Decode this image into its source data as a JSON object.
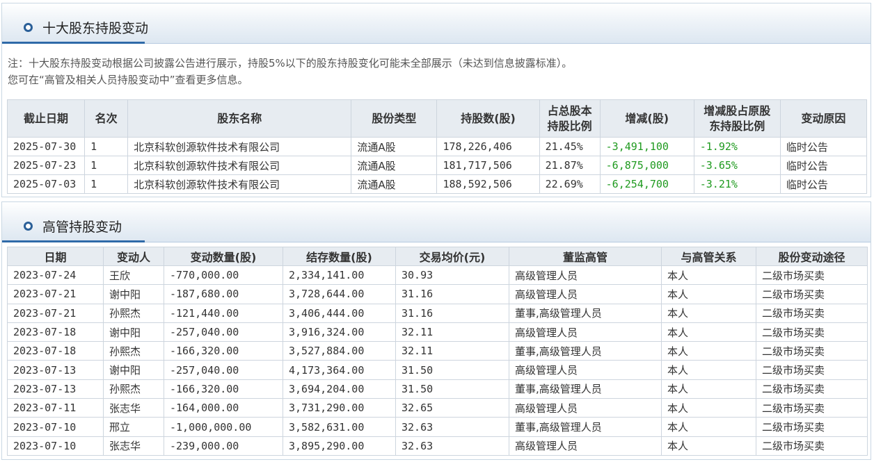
{
  "section1": {
    "title": "十大股东持股变动",
    "note_line1": "注：十大股东持股变动根据公司披露公告进行展示，持股5%以下的股东持股变化可能未全部展示（未达到信息披露标准）。",
    "note_line2": "您可在“高管及相关人员持股变动中”查看更多信息。",
    "headers": {
      "date": "截止日期",
      "rank": "名次",
      "holder": "股东名称",
      "share_type": "股份类型",
      "shares": "持股数(股)",
      "ratio_a": "占总股本",
      "ratio_b": "持股比例",
      "change": "增减(股)",
      "change_ratio_a": "增减股占原股",
      "change_ratio_b": "东持股比例",
      "reason": "变动原因"
    },
    "rows": [
      {
        "date": "2025-07-30",
        "rank": "1",
        "holder": "北京科软创源软件技术有限公司",
        "share_type": "流通A股",
        "shares": "178,226,406",
        "ratio": "21.45%",
        "change": "-3,491,100",
        "change_ratio": "-1.92%",
        "reason": "临时公告"
      },
      {
        "date": "2025-07-23",
        "rank": "1",
        "holder": "北京科软创源软件技术有限公司",
        "share_type": "流通A股",
        "shares": "181,717,506",
        "ratio": "21.87%",
        "change": "-6,875,000",
        "change_ratio": "-3.65%",
        "reason": "临时公告"
      },
      {
        "date": "2025-07-03",
        "rank": "1",
        "holder": "北京科软创源软件技术有限公司",
        "share_type": "流通A股",
        "shares": "188,592,506",
        "ratio": "22.69%",
        "change": "-6,254,700",
        "change_ratio": "-3.21%",
        "reason": "临时公告"
      }
    ]
  },
  "section2": {
    "title": "高管持股变动",
    "headers": {
      "date": "日期",
      "person": "变动人",
      "change_qty": "变动数量(股)",
      "remain_qty": "结存数量(股)",
      "avg_price": "交易均价(元)",
      "position": "董监高管",
      "relation": "与高管关系",
      "channel": "股份变动途径"
    },
    "rows": [
      {
        "date": "2023-07-24",
        "person": "王欣",
        "change_qty": "-770,000.00",
        "remain_qty": "2,334,141.00",
        "avg_price": "30.93",
        "position": "高级管理人员",
        "relation": "本人",
        "channel": "二级市场买卖"
      },
      {
        "date": "2023-07-21",
        "person": "谢中阳",
        "change_qty": "-187,680.00",
        "remain_qty": "3,728,644.00",
        "avg_price": "31.16",
        "position": "高级管理人员",
        "relation": "本人",
        "channel": "二级市场买卖"
      },
      {
        "date": "2023-07-21",
        "person": "孙熙杰",
        "change_qty": "-121,440.00",
        "remain_qty": "3,406,444.00",
        "avg_price": "31.16",
        "position": "董事,高级管理人员",
        "relation": "本人",
        "channel": "二级市场买卖"
      },
      {
        "date": "2023-07-18",
        "person": "谢中阳",
        "change_qty": "-257,040.00",
        "remain_qty": "3,916,324.00",
        "avg_price": "32.11",
        "position": "高级管理人员",
        "relation": "本人",
        "channel": "二级市场买卖"
      },
      {
        "date": "2023-07-18",
        "person": "孙熙杰",
        "change_qty": "-166,320.00",
        "remain_qty": "3,527,884.00",
        "avg_price": "32.11",
        "position": "董事,高级管理人员",
        "relation": "本人",
        "channel": "二级市场买卖"
      },
      {
        "date": "2023-07-13",
        "person": "谢中阳",
        "change_qty": "-257,040.00",
        "remain_qty": "4,173,364.00",
        "avg_price": "31.50",
        "position": "高级管理人员",
        "relation": "本人",
        "channel": "二级市场买卖"
      },
      {
        "date": "2023-07-13",
        "person": "孙熙杰",
        "change_qty": "-166,320.00",
        "remain_qty": "3,694,204.00",
        "avg_price": "31.50",
        "position": "董事,高级管理人员",
        "relation": "本人",
        "channel": "二级市场买卖"
      },
      {
        "date": "2023-07-11",
        "person": "张志华",
        "change_qty": "-164,000.00",
        "remain_qty": "3,731,290.00",
        "avg_price": "32.65",
        "position": "高级管理人员",
        "relation": "本人",
        "channel": "二级市场买卖"
      },
      {
        "date": "2023-07-10",
        "person": "邢立",
        "change_qty": "-1,000,000.00",
        "remain_qty": "3,582,631.00",
        "avg_price": "32.63",
        "position": "董事,高级管理人员",
        "relation": "本人",
        "channel": "二级市场买卖"
      },
      {
        "date": "2023-07-10",
        "person": "张志华",
        "change_qty": "-239,000.00",
        "remain_qty": "3,895,290.00",
        "avg_price": "32.63",
        "position": "高级管理人员",
        "relation": "本人",
        "channel": "二级市场买卖"
      }
    ]
  },
  "colors": {
    "negative": "#1f9a1f",
    "accent": "#2f6aa8",
    "header_bg": "#e7ecf1"
  }
}
